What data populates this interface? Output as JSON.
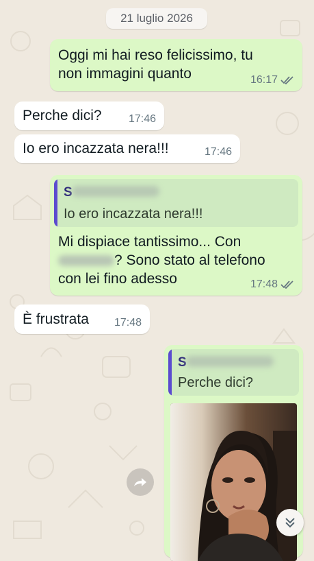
{
  "date_separator": "21 luglio 2026",
  "messages": [
    {
      "direction": "out",
      "text": "Oggi mi hai reso felicissimo, tu non immagini quanto",
      "time": "16:17",
      "status": "read"
    },
    {
      "direction": "in",
      "text": "Perche dici?",
      "time": "17:46"
    },
    {
      "direction": "in",
      "text": "Io ero incazzata nera!!!",
      "time": "17:46"
    },
    {
      "direction": "out",
      "quote": {
        "sender_initial": "S",
        "text": "Io ero incazzata nera!!!"
      },
      "text_part1": "Mi dispiace tantissimo... Con",
      "text_part2": "? Sono stato al telefono",
      "text_part3": "con lei fino adesso",
      "time": "17:48",
      "status": "read"
    },
    {
      "direction": "in",
      "text": "È frustrata",
      "time": "17:48"
    },
    {
      "direction": "out",
      "quote": {
        "sender_initial": "S",
        "text": "Perche dici?"
      },
      "media": "video"
    }
  ],
  "colors": {
    "outgoing_bubble": "#dcf8c6",
    "incoming_bubble": "#ffffff",
    "read_ticks": "#667781",
    "quote_bar": "#5b4ccf"
  },
  "icons": {
    "forward": "forward-icon",
    "scroll": "double-chevron-down-icon",
    "ticks": "double-check-icon"
  }
}
